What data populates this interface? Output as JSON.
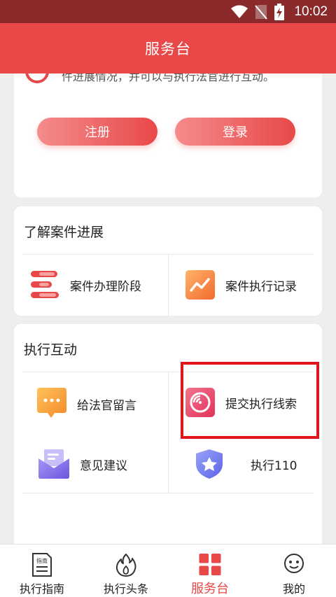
{
  "status_bar": {
    "time": "10:02"
  },
  "header": {
    "title": "服务台"
  },
  "intro_card": {
    "description": "件进展情况，并可以与执行法官进行互动。",
    "register_label": "注册",
    "login_label": "登录"
  },
  "progress_section": {
    "title": "了解案件进展",
    "items": [
      {
        "label": "案件办理阶段",
        "icon": "stage-list-icon"
      },
      {
        "label": "案件执行记录",
        "icon": "trend-chart-icon"
      }
    ]
  },
  "interaction_section": {
    "title": "执行互动",
    "items": [
      {
        "label": "给法官留言",
        "icon": "chat-bubble-icon"
      },
      {
        "label": "提交执行线索",
        "icon": "clue-disc-icon"
      },
      {
        "label": "意见建议",
        "icon": "mail-icon"
      },
      {
        "label": "执行110",
        "icon": "star-shield-icon"
      }
    ]
  },
  "bottom_nav": {
    "items": [
      {
        "label": "执行指南",
        "icon": "guide-book-icon",
        "active": false
      },
      {
        "label": "执行头条",
        "icon": "flame-icon",
        "active": false
      },
      {
        "label": "服务台",
        "icon": "grid-icon",
        "active": true
      },
      {
        "label": "我的",
        "icon": "smiley-face-icon",
        "active": false
      }
    ]
  },
  "icon_labels": {
    "guide": "指南"
  },
  "colors": {
    "primary": "#e84848",
    "status_bar": "#8b2a2b",
    "highlight": "#e0161b"
  }
}
